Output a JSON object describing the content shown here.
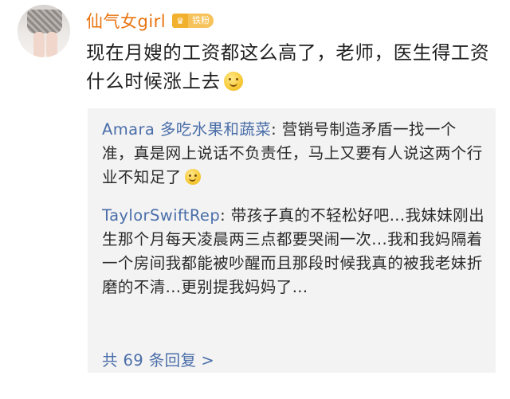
{
  "post": {
    "username": "仙气女girl",
    "badge_label": "铁粉",
    "badge_icon": "crown-icon",
    "text": "现在月嫂的工资都这么高了，老师，医生得工资什么时候涨上去",
    "emoji": "smile-emoji"
  },
  "replies": [
    {
      "name": "Amara 多吃水果和蔬菜",
      "separator": ": ",
      "text": "营销号制造矛盾一找一个准，真是网上说话不负责任，马上又要有人说这两个行业不知足了",
      "emoji": "smile-emoji"
    },
    {
      "name": "TaylorSwiftRep",
      "separator": ": ",
      "text": "带孩子真的不轻松好吧...我妹妹刚出生那个月每天凌晨两三点都要哭闹一次...我和我妈隔着一个房间我都能被吵醒而且那段时候我真的被我老妹折磨的不清...更别提我妈妈了..."
    }
  ],
  "more_replies": {
    "label": "共 69 条回复",
    "arrow": ">"
  },
  "colors": {
    "username": "#e8730f",
    "reply_name": "#4a6ea9",
    "reply_bg": "#f3f3f3",
    "badge": "#f6c25a"
  }
}
